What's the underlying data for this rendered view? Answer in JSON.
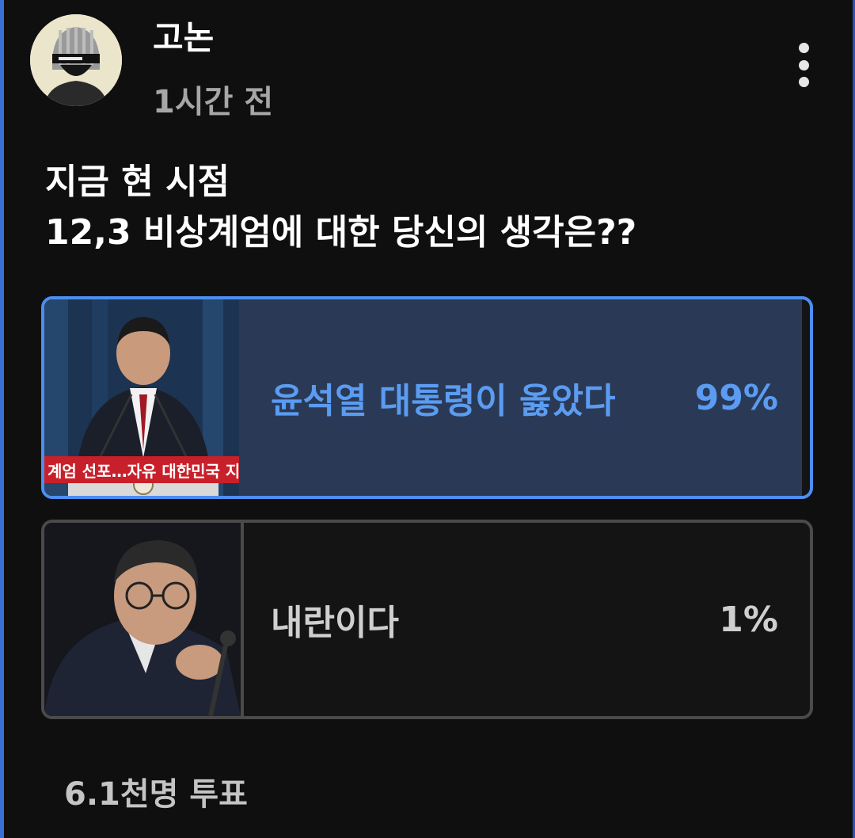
{
  "post": {
    "author": "고논",
    "time": "1시간 전",
    "title_lines": [
      "지금 현 시점",
      "12,3 비상계엄에 대한 당신의 생각은??"
    ]
  },
  "poll": {
    "options": [
      {
        "label": "윤석열 대통령이 옳았다",
        "percent": "99%",
        "value": 99,
        "selected": true,
        "image_caption": "계엄 선포…자유 대한민국 지"
      },
      {
        "label": "내란이다",
        "percent": "1%",
        "value": 1,
        "selected": false
      }
    ],
    "votes": "6.1천명 투표"
  },
  "icons": {
    "more": "more-vertical-icon",
    "avatar": "helmet-avatar"
  },
  "colors": {
    "accent": "#4d8ef0",
    "selected_text": "#5b9cf2",
    "background": "#0f0f10"
  }
}
